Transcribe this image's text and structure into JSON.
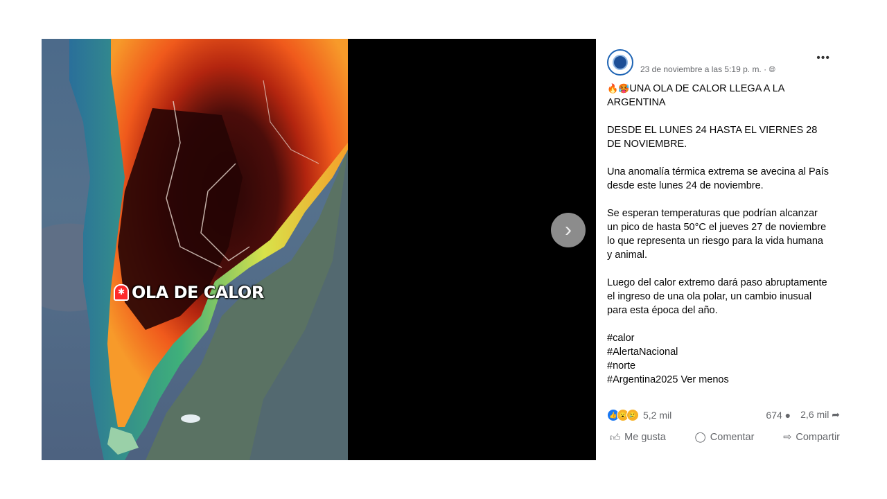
{
  "post": {
    "timestamp": "23 de noviembre a las 5:19 p. m. ·",
    "more_label": "•••",
    "headline": "UNA OLA DE CALOR LLEGA A LA ARGENTINA",
    "paragraphs": [
      "DESDE EL LUNES 24 HASTA EL VIERNES 28 DE NOVIEMBRE.",
      "Una anomalía térmica extrema se avecina al País desde este lunes 24 de noviembre.",
      "Se esperan temperaturas que podrían alcanzar un pico de hasta 50°C el jueves 27 de noviembre lo que representa un riesgo para la vida humana y animal.",
      "Luego del calor extremo dará paso abruptamente el ingreso de una ola polar, un cambio inusual para esta época del año."
    ],
    "hashtags": [
      "#calor",
      "#AlertaNacional",
      "#norte",
      "#Argentina2025"
    ],
    "see_less": "Ver menos"
  },
  "media": {
    "overlay_text": "OLA DE CALOR",
    "next_icon": "chevron-right-icon"
  },
  "stats": {
    "reactions": "5,2 mil",
    "comments": "674",
    "shares": "2,6 mil"
  },
  "actions": {
    "like": "Me gusta",
    "comment": "Comentar",
    "share": "Compartir"
  }
}
